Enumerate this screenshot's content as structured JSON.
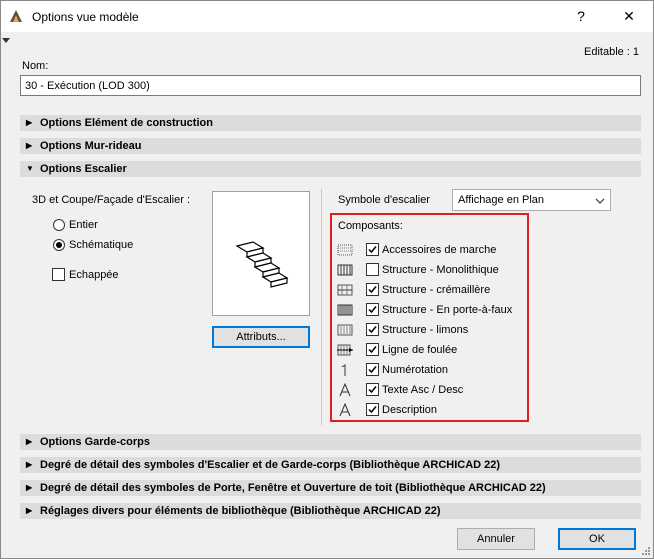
{
  "window": {
    "title": "Options vue modèle",
    "help_label": "?",
    "close_label": "✕",
    "editable_label": "Editable : 1"
  },
  "name_field": {
    "label": "Nom:",
    "value": "30 - Exécution (LOD 300)"
  },
  "sections": {
    "elements": "Options Elément de construction",
    "mur_rideau": "Options Mur-rideau",
    "escalier": "Options Escalier",
    "garde_corps": "Options Garde-corps",
    "detail_escalier": "Degré de détail des symboles d'Escalier et de Garde-corps (Bibliothèque ARCHICAD 22)",
    "detail_porte": "Degré de détail des symboles de Porte, Fenêtre et Ouverture de toit (Bibliothèque ARCHICAD 22)",
    "reglages": "Réglages divers pour éléments de bibliothèque (Bibliothèque ARCHICAD 22)"
  },
  "escalier": {
    "view_label": "3D et Coupe/Façade d'Escalier :",
    "radio_entier": "Entier",
    "radio_schematique": "Schématique",
    "selected": "Schématique",
    "echappee_label": "Echappée",
    "echappee_checked": false,
    "attributs_button": "Attributs...",
    "symbole_label": "Symbole d'escalier",
    "symbole_value": "Affichage en Plan",
    "composants_label": "Composants:",
    "composants": [
      {
        "label": "Accessoires de marche",
        "checked": true,
        "icon": "hatch-grid-icon"
      },
      {
        "label": "Structure - Monolithique",
        "checked": false,
        "icon": "vertical-lines-icon"
      },
      {
        "label": "Structure - crémaillère",
        "checked": true,
        "icon": "horizontal-hatch-icon"
      },
      {
        "label": "Structure - En porte-à-faux",
        "checked": true,
        "icon": "dense-lines-icon"
      },
      {
        "label": "Structure - limons",
        "checked": true,
        "icon": "framed-lines-icon"
      },
      {
        "label": "Ligne de foulée",
        "checked": true,
        "icon": "walking-line-icon"
      },
      {
        "label": "Numérotation",
        "checked": true,
        "icon": "number-one-icon"
      },
      {
        "label": "Texte Asc / Desc",
        "checked": true,
        "icon": "letter-a-icon"
      },
      {
        "label": "Description",
        "checked": true,
        "icon": "letter-a-icon"
      }
    ]
  },
  "footer": {
    "cancel": "Annuler",
    "ok": "OK"
  },
  "colors": {
    "highlight_box": "#e01e24",
    "section_bg": "#dcdcdc",
    "primary_border": "#0078d7"
  }
}
